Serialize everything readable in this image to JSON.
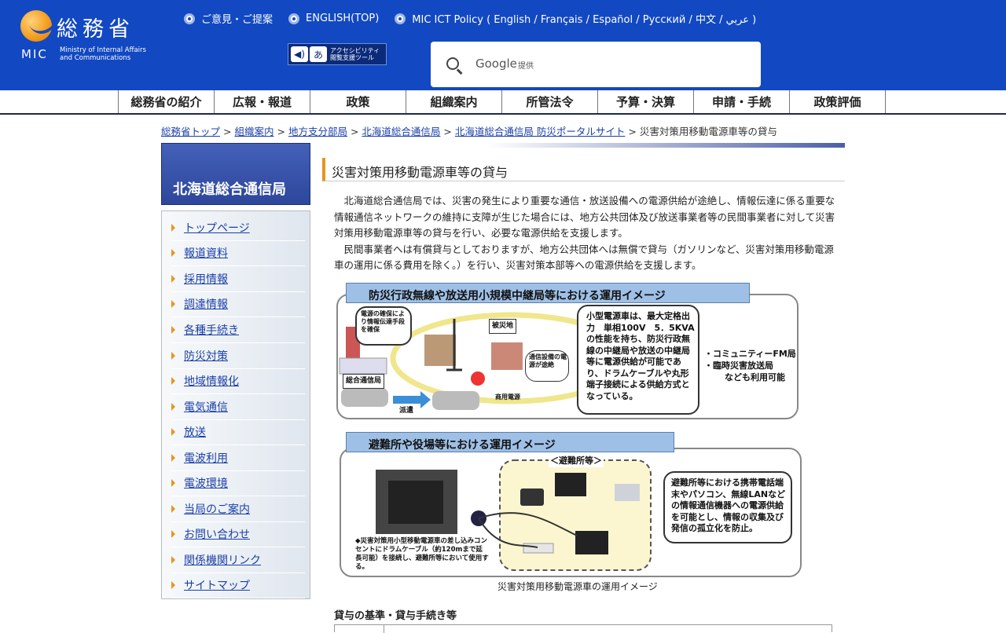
{
  "header": {
    "logo_jp": "総務省",
    "logo_mic": "MIC",
    "logo_en_line1": "Ministry of Internal Affairs",
    "logo_en_line2": "and Communications",
    "links": [
      {
        "label": "ご意見・ご提案"
      },
      {
        "label": "ENGLISH(TOP)"
      },
      {
        "label": "MIC ICT Policy ( English / Français / Español / Русский / 中文 / عربي )"
      }
    ],
    "accessibility_label_line1": "アクセシビリティ",
    "accessibility_label_line2": "閲覧支援ツール",
    "search": {
      "brand": "Google",
      "suffix": "提供"
    }
  },
  "nav": [
    "総務省の紹介",
    "広報・報道",
    "政策",
    "組織案内",
    "所管法令",
    "予算・決算",
    "申請・手続",
    "政策評価"
  ],
  "breadcrumb": {
    "links": [
      "総務省トップ",
      "組織案内",
      "地方支分部局",
      "北海道総合通信局",
      "北海道総合通信局 防災ポータルサイト"
    ],
    "separator": ">",
    "current": "災害対策用移動電源車等の貸与"
  },
  "sidebar": {
    "title": "北海道総合通信局",
    "items": [
      "トップページ",
      "報道資料",
      "採用情報",
      "調達情報",
      "各種手続き",
      "防災対策",
      "地域情報化",
      "電気通信",
      "放送",
      "電波利用",
      "電波環境",
      "当局のご案内",
      "お問い合わせ",
      "関係機関リンク",
      "サイトマップ"
    ]
  },
  "main": {
    "title": "災害対策用移動電源車等の貸与",
    "paragraph1": "北海道総合通信局では、災害の発生により重要な通信・放送設備への電源供給が途絶し、情報伝達に係る重要な情報通信ネットワークの維持に支障が生じた場合には、地方公共団体及び放送事業者等の民間事業者に対して災害対策用移動電源車等の貸与を行い、必要な電源供給を支援します。",
    "paragraph2": "民間事業者へは有償貸与としておりますが、地方公共団体へは無償で貸与（ガソリンなど、災害対策用移動電源車の運用に係る費用を除く。）を行い、災害対策本部等への電源供給を支援します。",
    "figure": {
      "title1": "防災行政無線や放送用小規模中継局等における運用イメージ",
      "callout_power": "電源の確保により情報伝達手段を確保",
      "label_disaster": "被災地",
      "label_station": "総合通信局",
      "label_dispatch": "派遣",
      "label_outage": "通信設備の電源が途絶",
      "label_commercial": "商用電源",
      "callout_spec": "小型電源車は、最大定格出力　単相100V　5．5KVAの性能を持ち、防災行政無線の中継局や放送の中継局等に電源供給が可能であり、ドラムケーブルや丸形端子接続による供給方式となっている。",
      "note_fm": "・コミュニティーFM局",
      "note_temp": "・臨時災害放送局",
      "note_also": "なども利用可能",
      "title2": "避難所や役場等における運用イメージ",
      "label_shelter": "＜避難所等＞",
      "callout_car": "◆災害対策用小型移動電源車の差し込みコンセントにドラムケーブル（約120mまで延長可能）を接続し、避難所等において使用する。",
      "callout_shelter": "避難所等における携帯電話端末やパソコン、無線LANなどの情報通信機器への電源供給を可能とし、情報の収集及び発信の孤立化を防止。"
    },
    "caption": "災害対策用移動電源車の運用イメージ",
    "section_heading": "貸与の基準・貸与手続き等"
  }
}
